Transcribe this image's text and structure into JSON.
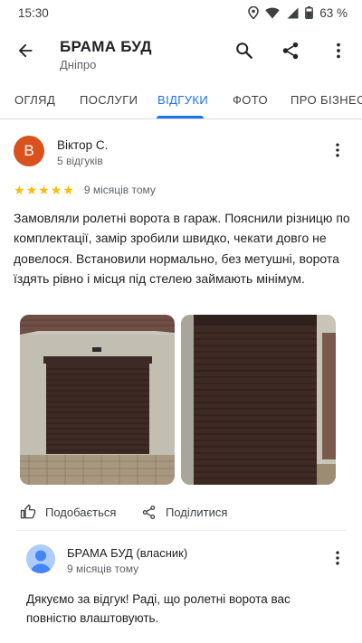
{
  "status_bar": {
    "time": "15:30",
    "battery": "63 %",
    "icons": [
      "location-icon",
      "wifi-icon",
      "signal-icon",
      "battery-icon"
    ]
  },
  "app_bar": {
    "title": "БРАМА БУД",
    "subtitle": "Дніпро",
    "icons": [
      "back-arrow-icon",
      "search-icon",
      "share-icon",
      "more-vert-icon"
    ]
  },
  "tabs": [
    {
      "label": "ОГЛЯД",
      "active": false
    },
    {
      "label": "ПОСЛУГИ",
      "active": false
    },
    {
      "label": "ВІДГУКИ",
      "active": true
    },
    {
      "label": "ФОТО",
      "active": false
    },
    {
      "label": "ПРО БІЗНЕС",
      "active": false
    }
  ],
  "review": {
    "avatar_letter": "В",
    "avatar_color": "#d9511d",
    "author": "Віктор С.",
    "author_meta": "5 відгуків",
    "rating": 5,
    "rating_max": 5,
    "time": "9 місяців тому",
    "text": "Замовляли ролетні ворота в гараж. Пояснили різницю по комплектації, замір зробили швидко, чекати довго не довелося. Встановили нормально, без метушні, ворота їздять рівно і місця під стелею займають мінімум.",
    "photos": [
      "garage-door-photo-front",
      "garage-door-photo-closeup"
    ],
    "actions": {
      "like_label": "Подобається",
      "share_label": "Поділитися"
    }
  },
  "owner_reply": {
    "name": "БРАМА БУД (власник)",
    "time": "9 місяців тому",
    "text": "Дякуємо за відгук! Раді, що ролетні ворота вас повністю влаштовують."
  },
  "colors": {
    "accent": "#1a73e8",
    "star": "#fbbc04",
    "text_primary": "#202124",
    "text_secondary": "#5f6368"
  }
}
